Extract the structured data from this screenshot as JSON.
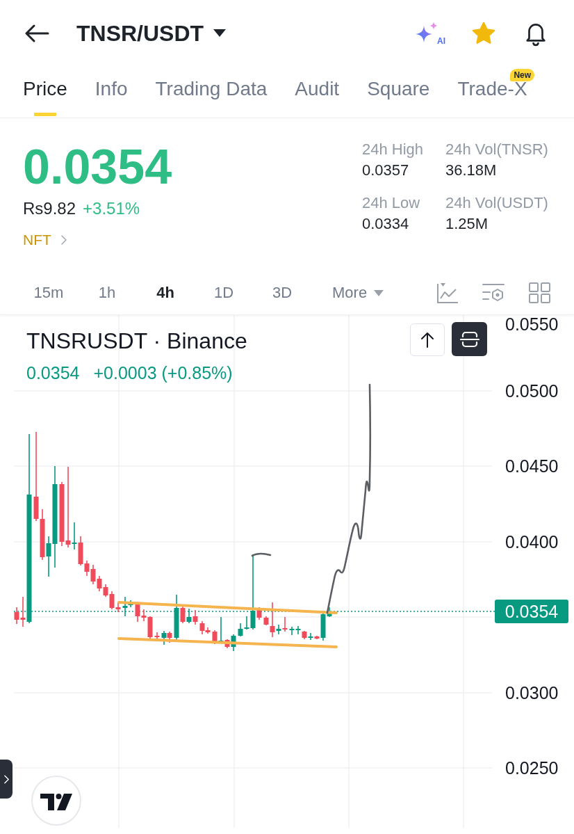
{
  "header": {
    "title": "TNSR/USDT",
    "ai_label": "AI",
    "favorite": true
  },
  "tabs": [
    {
      "label": "Price",
      "selected": true
    },
    {
      "label": "Info",
      "selected": false
    },
    {
      "label": "Trading Data",
      "selected": false
    },
    {
      "label": "Audit",
      "selected": false
    },
    {
      "label": "Square",
      "selected": false
    },
    {
      "label": "Trade-X",
      "selected": false,
      "badge": "New"
    }
  ],
  "ticker": {
    "price": "0.0354",
    "fiat_price": "Rs9.82",
    "change": "+3.51%",
    "tag": "NFT"
  },
  "stats": [
    {
      "label": "24h High",
      "value": "0.0357"
    },
    {
      "label": "24h Vol(TNSR)",
      "value": "36.18M"
    },
    {
      "label": "24h Low",
      "value": "0.0334"
    },
    {
      "label": "24h Vol(USDT)",
      "value": "1.25M"
    }
  ],
  "intervals": [
    {
      "label": "15m",
      "selected": false
    },
    {
      "label": "1h",
      "selected": false
    },
    {
      "label": "4h",
      "selected": true
    },
    {
      "label": "1D",
      "selected": false
    },
    {
      "label": "3D",
      "selected": false
    }
  ],
  "more_label": "More",
  "chart": {
    "title": "TNSRUSDT · Binance",
    "last_price": "0.0354",
    "change": "+0.0003 (+0.85%)",
    "axis_labels": [
      "0.0550",
      "0.0500",
      "0.0450",
      "0.0400",
      "0.0300",
      "0.0250"
    ],
    "price_tag": "0.0354"
  }
}
